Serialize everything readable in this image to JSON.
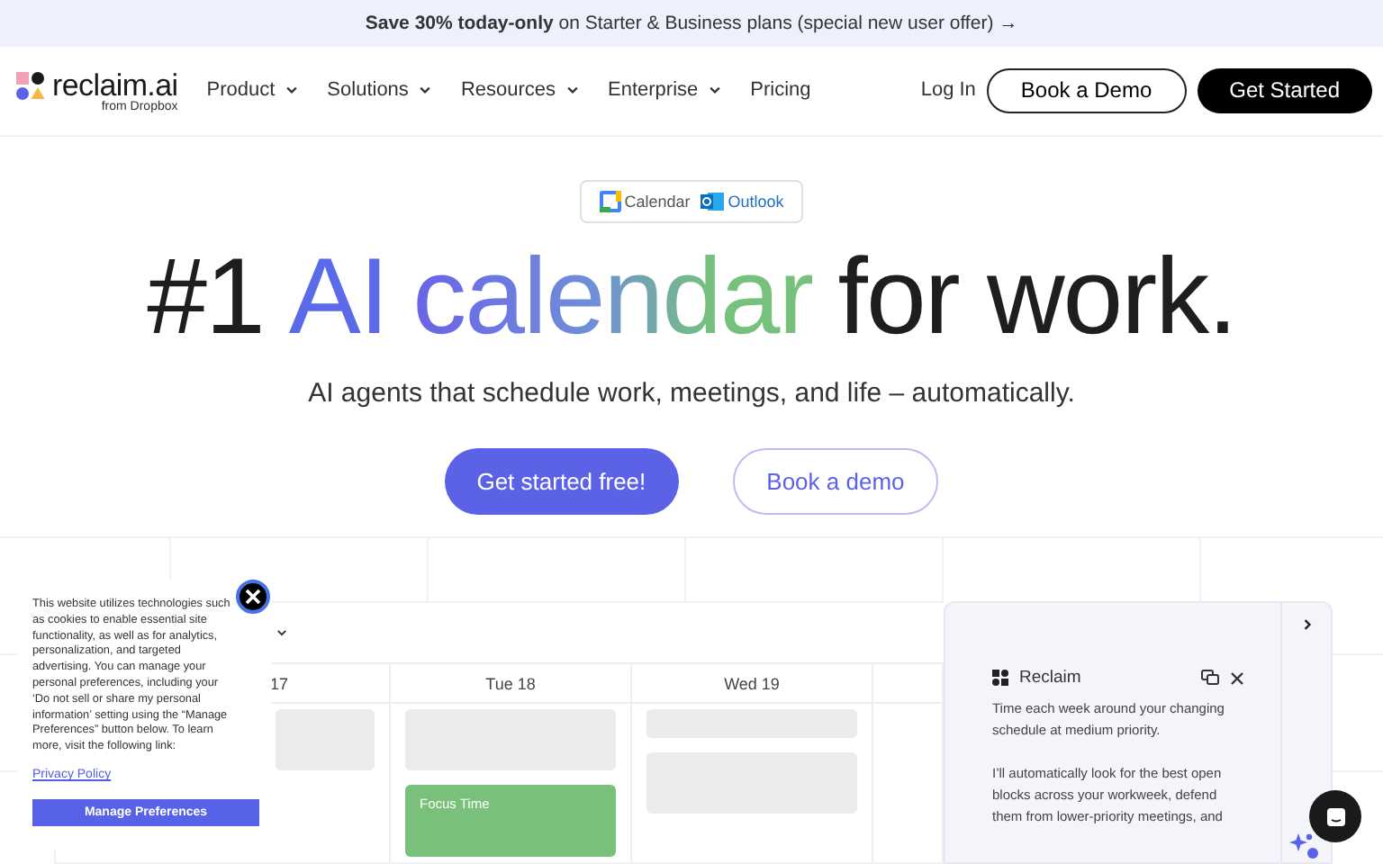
{
  "promo": {
    "text": "**Save 30% today-only** on Starter & Business plans (special new user offer) →"
  },
  "nav": {
    "logo": "reclaim.ai",
    "logo_sub": "from Dropbox",
    "items": [
      {
        "label": "Product",
        "dropdown": true
      },
      {
        "label": "Solutions",
        "dropdown": true
      },
      {
        "label": "Resources",
        "dropdown": true
      },
      {
        "label": "Enterprise",
        "dropdown": true
      },
      {
        "label": "Pricing",
        "dropdown": false
      }
    ],
    "login": "Log In",
    "demo": "Book a Demo",
    "start": "Get Started"
  },
  "integrations": [
    {
      "kind": "google",
      "label": "Calendar"
    },
    {
      "kind": "outlook",
      "label": "Outlook"
    }
  ],
  "hero": {
    "prefix": "#1",
    "accent": "AI",
    "gradient": "calendar",
    "suffix": "for work.",
    "subtitle": "AI agents that schedule work, meetings, and life – automatically.",
    "primary": "Get started free!",
    "secondary": "Book a demo"
  },
  "calendar": {
    "columns": [
      {
        "day": "17",
        "events": [
          {
            "kind": "block"
          }
        ]
      },
      {
        "day": "Tue 18",
        "events": [
          {
            "kind": "block"
          },
          {
            "kind": "focus",
            "label": "Focus Time"
          }
        ]
      },
      {
        "day": "Wed 19",
        "events": [
          {
            "kind": "short"
          },
          {
            "kind": "block"
          }
        ]
      }
    ]
  },
  "assistant": {
    "title": "Reclaim",
    "paragraphs": [
      "Time each week around your changing schedule at medium priority.",
      "I’ll automatically look for the best open blocks across your workweek, defend them from lower-priority meetings, and"
    ]
  },
  "cookie": {
    "text": "This website utilizes technologies such as cookies to enable essential site functionality, as well as for analytics, personalization, and targeted advertising. You can manage your personal preferences, including your ‘Do not sell or share my personal information’ setting using the “Manage Preferences” button below. To learn more, visit the following link:",
    "link": "Privacy Policy",
    "button": "Manage Preferences"
  }
}
